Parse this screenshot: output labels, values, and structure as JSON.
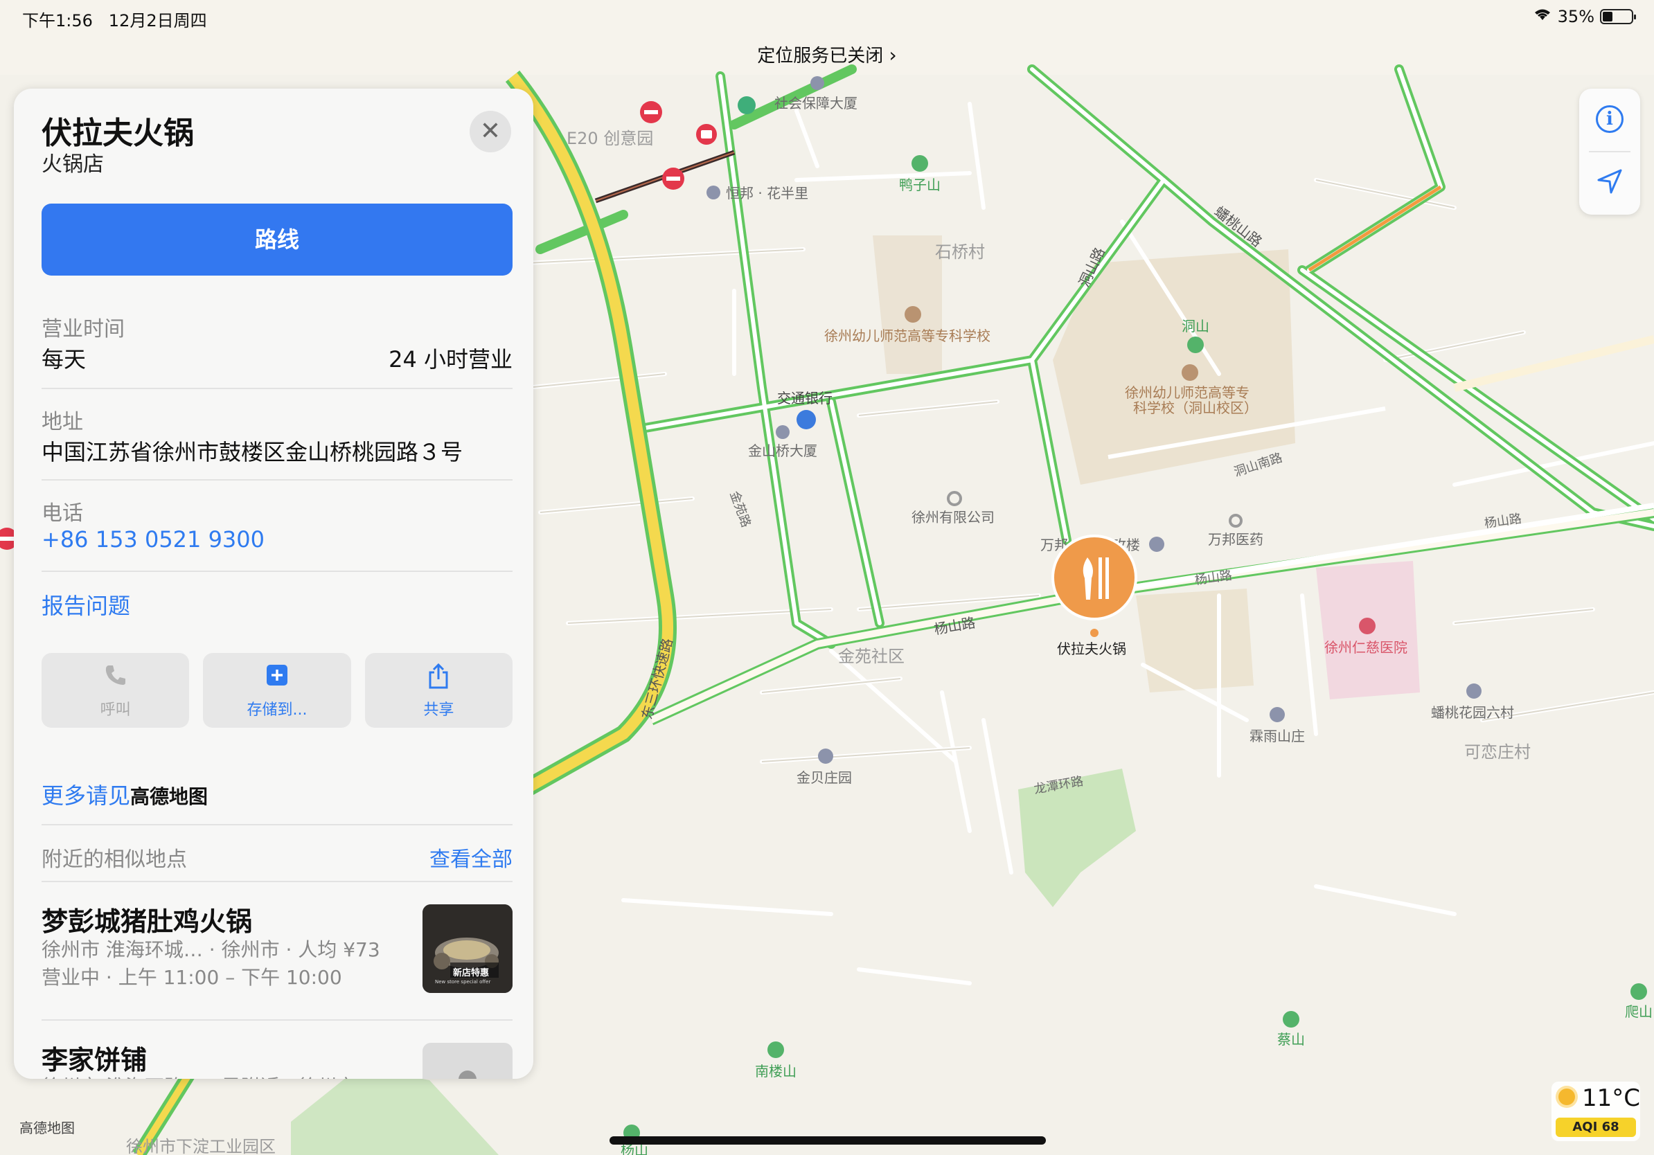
{
  "status_bar": {
    "time": "下午1:56",
    "date": "12月2日周四",
    "battery": "35%",
    "battery_level": 0.35
  },
  "location_banner": "定位服务已关闭",
  "place": {
    "name": "伏拉夫火锅",
    "category": "火锅店"
  },
  "route_button": "路线",
  "hours": {
    "label": "营业时间",
    "days": "每天",
    "value": "24 小时营业"
  },
  "address": {
    "label": "地址",
    "value": "中国江苏省徐州市鼓楼区金山桥桃园路３号"
  },
  "phone": {
    "label": "电话",
    "value": "+86 153 0521 9300"
  },
  "report_link": "报告问题",
  "actions": [
    {
      "label": "呼叫",
      "icon": "phone-icon"
    },
    {
      "label": "存储到...",
      "icon": "plus-square-icon"
    },
    {
      "label": "共享",
      "icon": "share-icon"
    }
  ],
  "more_info": {
    "text": "更多请见",
    "brand": "高德地图"
  },
  "nearby": {
    "label": "附近的相似地点",
    "view_all": "查看全部",
    "items": [
      {
        "name": "梦彭城猪肚鸡火锅",
        "detail": "徐州市 淮海环城… · 徐州市 · 人均 ¥73",
        "hours": "营业中 · 上午 11:00 – 下午 10:00",
        "thumb_text": "新店特惠",
        "thumb_subtext": "New store special offer"
      },
      {
        "name": "李家饼铺",
        "detail": "徐州市 淮海西路… · 早附近 · 徐州市"
      }
    ]
  },
  "map_labels": {
    "e20": "E20 创意园",
    "social": "社会保障大厦",
    "hengbang": "恒邦 · 花半里",
    "yazishan": "鸭子山",
    "shiqiao": "石桥村",
    "school1": "徐州幼儿师范高等专科学校",
    "dongshan": "洞山",
    "school2a": "徐州幼儿师范高等专",
    "school2b": "科学校（洞山校区）",
    "jiaotong": "交通银行",
    "jinshanqiao": "金山桥大厦",
    "youxian": "徐州有限公司",
    "wanbang": "万邦",
    "meiguilou": "玫楼",
    "wanbangyiyao": "万邦医药",
    "yangshanlu1": "杨山路",
    "yangshanlu2": "杨山路",
    "yangshanlu3": "杨山路",
    "jinyuan": "金苑社区",
    "restaurant": "伏拉夫火锅",
    "renci": "徐州仁慈医院",
    "panhua": "蟠桃花园六村",
    "keliancun": "可恋庄村",
    "linyu": "霖雨山庄",
    "jinbei": "金贝庄园",
    "longtan": "龙潭环路",
    "nanlou": "南楼山",
    "caishan": "蔡山",
    "pashan": "爬山",
    "donghuan": "东三环快速路",
    "dongshanlu": "洞山路",
    "pantaoshanlu": "蟠桃山路",
    "dongshannanlu": "洞山南路",
    "jinyuanlu": "金苑路",
    "xiadian": "徐州市下淀工业园区",
    "yangshan": "杨山",
    "gaode": "高德地图"
  },
  "weather": {
    "temp": "11°C",
    "aqi": "AQI 68"
  },
  "colors": {
    "accent": "#3378f0",
    "restaurant_pin": "#ef9a4a",
    "road_green": "#62c760",
    "expressway": "#f4d94e",
    "hospital": "#d9566a"
  }
}
